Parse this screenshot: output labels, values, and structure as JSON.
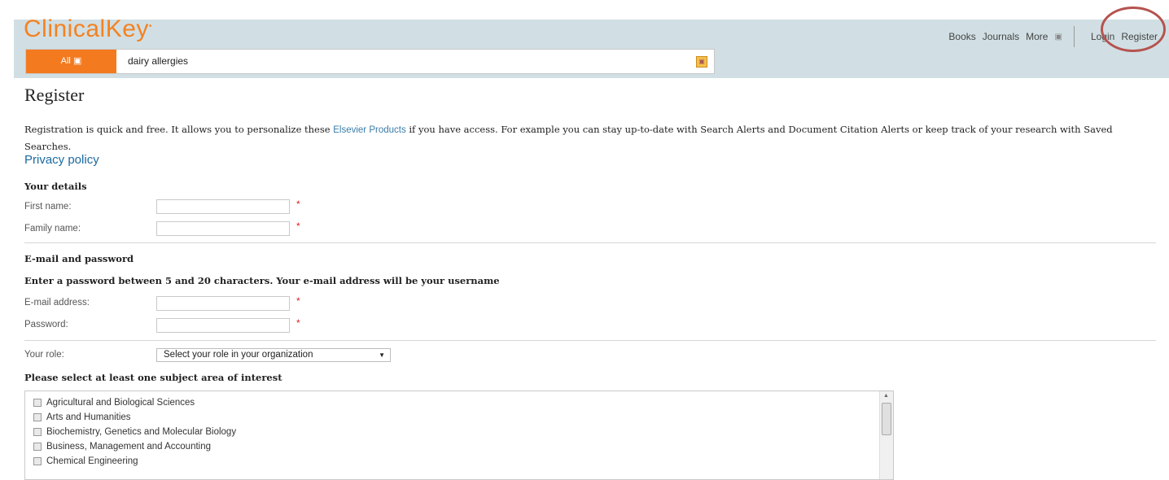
{
  "header": {
    "logo": "ClinicalKey",
    "logo_mark": "•",
    "nav": [
      "Books",
      "Journals",
      "More"
    ],
    "login": "Login",
    "register": "Register"
  },
  "search": {
    "scope": "All",
    "value": "dairy allergies"
  },
  "page": {
    "title": "Register",
    "intro_pre": "Registration is quick and free. It allows you to personalize these ",
    "intro_link": "Elsevier Products",
    "intro_post": " if you have access. For example you can stay up-to-date with Search Alerts and Document Citation Alerts or keep track of your research with Saved Searches.",
    "privacy": "Privacy policy"
  },
  "details": {
    "heading": "Your details",
    "first_name_label": "First name:",
    "family_name_label": "Family name:",
    "required_marker": "*"
  },
  "credentials": {
    "heading": "E-mail and password",
    "instruction": "Enter a password between 5 and 20 characters. Your e-mail address will be your username",
    "email_label": "E-mail address:",
    "password_label": "Password:"
  },
  "role": {
    "label": "Your role:",
    "selected": "Select your role in your organization"
  },
  "subjects": {
    "heading": "Please select at least one subject area of interest",
    "items": [
      "Agricultural and Biological Sciences",
      "Arts and Humanities",
      "Biochemistry, Genetics and Molecular Biology",
      "Business, Management and Accounting",
      "Chemical Engineering"
    ]
  },
  "colors": {
    "brand_orange": "#f47a1f",
    "header_bg": "#d1dfe4",
    "link_blue": "#1a6aa0",
    "highlight": "#b5534f"
  }
}
